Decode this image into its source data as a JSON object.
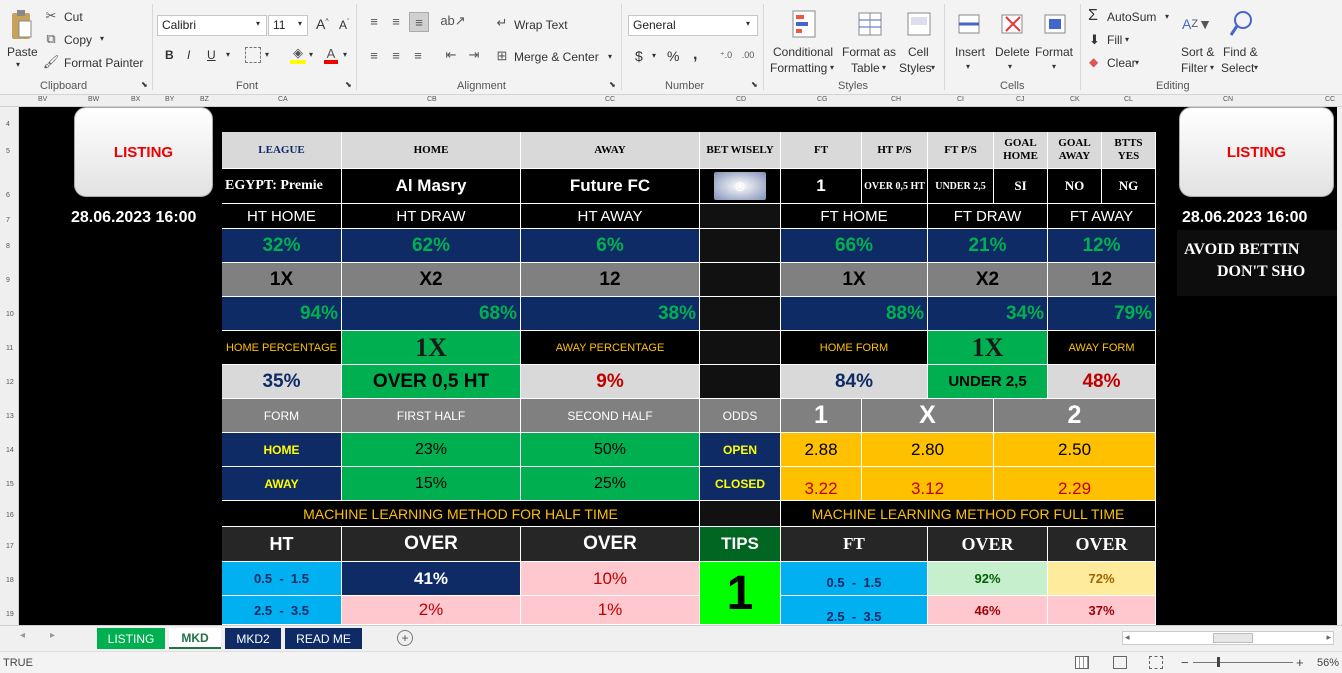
{
  "ribbon": {
    "clipboard": {
      "paste": "Paste",
      "cut": "Cut",
      "copy": "Copy",
      "painter": "Format Painter",
      "group": "Clipboard"
    },
    "font": {
      "name": "Calibri",
      "size": "11",
      "group": "Font",
      "bold": "B",
      "italic": "I",
      "underline": "U"
    },
    "alignment": {
      "wrap": "Wrap Text",
      "merge": "Merge & Center",
      "group": "Alignment"
    },
    "number": {
      "format": "General",
      "group": "Number",
      "currency": "$",
      "percent": "%",
      "comma": ","
    },
    "styles": {
      "cond1": "Conditional",
      "cond2": "Formatting",
      "fmt1": "Format as",
      "fmt2": "Table",
      "cell1": "Cell",
      "cell2": "Styles",
      "group": "Styles"
    },
    "cells": {
      "insert": "Insert",
      "delete": "Delete",
      "format": "Format",
      "group": "Cells"
    },
    "editing": {
      "autosum": "AutoSum",
      "fill": "Fill",
      "clear": "Clear",
      "sort1": "Sort &",
      "sort2": "Filter",
      "find1": "Find &",
      "find2": "Select",
      "group": "Editing"
    }
  },
  "colheaders": [
    "BV",
    "BW",
    "BX",
    "BY",
    "BZ",
    "CA",
    "CB",
    "CC",
    "CD",
    "CG",
    "CH",
    "CI",
    "CJ",
    "CK",
    "CL",
    "CN",
    "CC"
  ],
  "rowheaders": [
    "4",
    "5",
    "6",
    "7",
    "8",
    "9",
    "10",
    "11",
    "12",
    "13",
    "14",
    "15",
    "16",
    "17",
    "18",
    "19"
  ],
  "left": {
    "listing": "LISTING",
    "date": "28.06.2023 16:00"
  },
  "right": {
    "listing": "LISTING",
    "date": "28.06.2023 16:00",
    "avoid1": "AVOID BETTIN",
    "avoid2": "DON'T SHO"
  },
  "hdr": {
    "league": "LEAGUE",
    "home": "HOME",
    "away": "AWAY",
    "bet": "BET WISELY",
    "ft": "FT",
    "htps": "HT P/S",
    "ftps": "FT P/S",
    "goalhome1": "GOAL",
    "goalhome2": "HOME",
    "goalaway1": "GOAL",
    "goalaway2": "AWAY",
    "btts1": "BTTS",
    "btts2": "YES"
  },
  "match": {
    "league": "EGYPT: Premie",
    "home": "Al Masry",
    "away": "Future FC",
    "ft": "1",
    "htps": "OVER 0,5 HT",
    "ftps": "UNDER 2,5",
    "goalhome": "SI",
    "goalaway": "NO",
    "btts": "NG"
  },
  "row7": {
    "hthome": "HT HOME",
    "htdraw": "HT DRAW",
    "htaway": "HT AWAY",
    "fthome": "FT HOME",
    "ftdraw": "FT DRAW",
    "ftaway": "FT AWAY"
  },
  "row8": {
    "a": "32%",
    "b": "62%",
    "c": "6%",
    "d": "66%",
    "e": "21%",
    "f": "12%"
  },
  "row9": {
    "a": "1X",
    "b": "X2",
    "c": "12",
    "d": "1X",
    "e": "X2",
    "f": "12"
  },
  "row10": {
    "a": "94%",
    "b": "68%",
    "c": "38%",
    "d": "88%",
    "e": "34%",
    "f": "79%"
  },
  "row11": {
    "homepct": "HOME PERCENTAGE",
    "mid": "1X",
    "awaypct": "AWAY PERCENTAGE",
    "homeform": "HOME FORM",
    "mid2": "1X",
    "awayform": "AWAY FORM"
  },
  "row12": {
    "a": "35%",
    "b": "OVER 0,5 HT",
    "c": "9%",
    "d": "84%",
    "e": "UNDER 2,5",
    "f": "48%"
  },
  "row13": {
    "form": "FORM",
    "first": "FIRST HALF",
    "second": "SECOND HALF",
    "odds": "ODDS",
    "o1": "1",
    "ox": "X",
    "o2": "2"
  },
  "row14": {
    "label": "HOME",
    "first": "23%",
    "second": "50%",
    "odds": "OPEN",
    "v1": "2.88",
    "vx": "2.80",
    "v2": "2.50"
  },
  "row15": {
    "label": "AWAY",
    "first": "15%",
    "second": "25%",
    "odds": "CLOSED",
    "v1": "3.22",
    "vx": "3.12",
    "v2": "2.29"
  },
  "row16": {
    "left": "MACHINE LEARNING METHOD FOR HALF TIME",
    "right": "MACHINE LEARNING METHOD FOR FULL TIME"
  },
  "row17": {
    "ht": "HT",
    "over1": "OVER",
    "over2": "OVER",
    "tips": "TIPS",
    "ft": "FT",
    "over3": "OVER",
    "over4": "OVER"
  },
  "row18": {
    "a": "0.5  -  1.5",
    "b": "41%",
    "c": "10%",
    "tip": "1",
    "d": "0.5  -  1.5",
    "e": "92%",
    "f": "72%"
  },
  "row19": {
    "a": "2.5  -  3.5",
    "b": "2%",
    "c": "1%",
    "d": "2.5  -  3.5",
    "e": "46%",
    "f": "37%"
  },
  "tabs": [
    "LISTING",
    "MKD",
    "MKD2",
    "READ ME"
  ],
  "status": {
    "mode": "TRUE",
    "zoom": "56%"
  }
}
